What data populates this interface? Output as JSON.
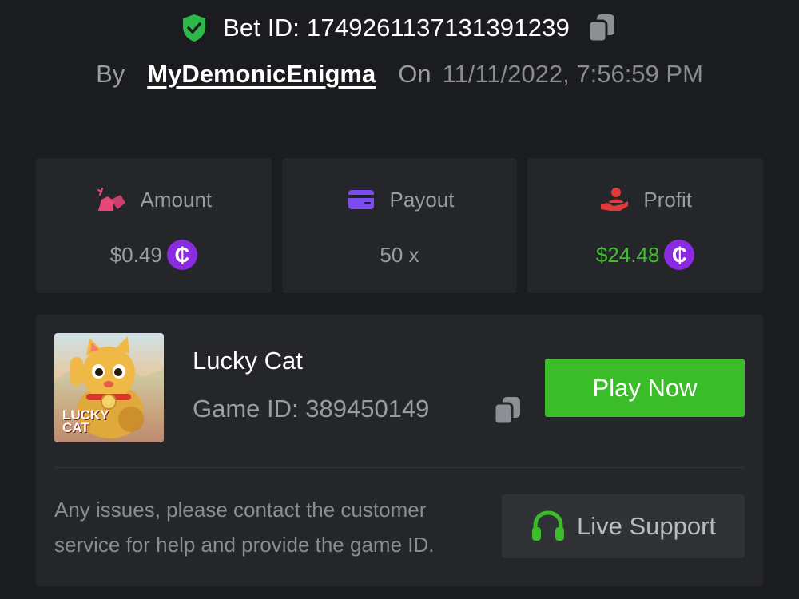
{
  "bet": {
    "id_text": "Bet ID: 1749261137131391239",
    "by_label": "By",
    "username": "MyDemonicEnigma",
    "on_label": "On",
    "timestamp": "11/11/2022, 7:56:59 PM",
    "shield_icon": "shield-check-icon",
    "copy_icon": "copy-icon"
  },
  "stats": [
    {
      "label": "Amount",
      "value": "$0.49",
      "icon": "money-bag-icon",
      "icon_color": "#e8477a",
      "show_coin": true
    },
    {
      "label": "Payout",
      "value": "50 x",
      "icon": "wallet-card-icon",
      "icon_color": "#7b4df0",
      "show_coin": false
    },
    {
      "label": "Profit",
      "value": "$24.48",
      "icon": "hand-holding-user-icon",
      "icon_color": "#e03a3a",
      "show_coin": true,
      "value_color": "#3fbf2a"
    }
  ],
  "coin_symbol": "₵",
  "game": {
    "name": "Lucky Cat",
    "id_text": "Game ID: 389450149",
    "thumb_line1": "LUCKY",
    "thumb_line2": "CAT",
    "play_label": "Play Now"
  },
  "help": {
    "text": "Any issues, please contact the customer service for help and provide the game ID.",
    "support_label": "Live Support",
    "support_icon": "headset-icon"
  },
  "colors": {
    "background": "#1b1c1f",
    "card": "#24262a",
    "accent_green": "#3bbd2a",
    "coin_purple": "#8a2be2"
  }
}
